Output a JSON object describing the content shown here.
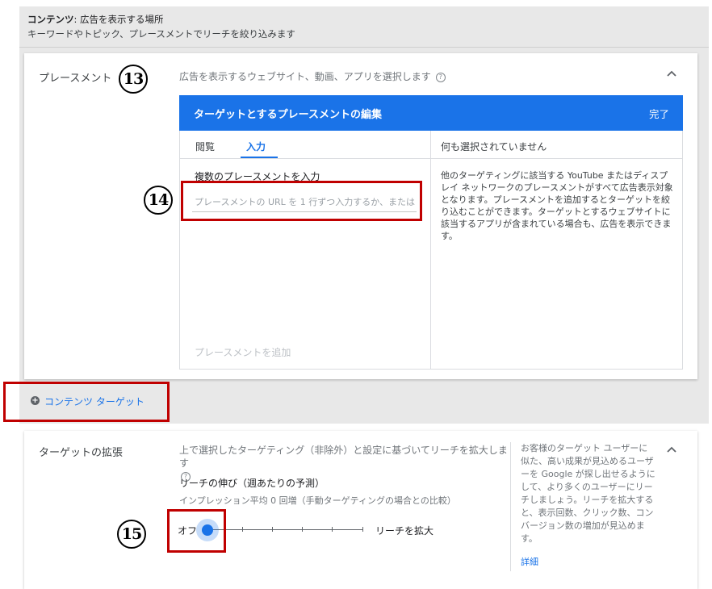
{
  "header": {
    "title_bold": "コンテンツ",
    "title_rest": ": 広告を表示する場所",
    "subtitle": "キーワードやトピック、プレースメントでリーチを絞り込みます"
  },
  "placement": {
    "label": "プレースメント",
    "description": "広告を表示するウェブサイト、動画、アプリを選択します",
    "help_icon": "?",
    "chevron": "^"
  },
  "badges": {
    "b13": "13",
    "b14": "14",
    "b15": "15"
  },
  "editor": {
    "title": "ターゲットとするプレースメントの編集",
    "done": "完了",
    "tabs": [
      "閲覧",
      "入力"
    ],
    "active_tab": "入力",
    "none_selected": "何も選択されていません",
    "multi_label": "複数のプレースメントを入力",
    "url_placeholder": "プレースメントの URL を 1 行ずつ入力するか、または...",
    "add_placement": "プレースメントを追加",
    "info": "他のターゲティングに該当する YouTube またはディスプレイ ネットワークのプレースメントがすべて広告表示対象となります。プレースメントを追加するとターゲットを絞り込むことができます。ターゲットとするウェブサイトに該当するアプリが含まれている場合も、広告を表示できます。"
  },
  "content_target": {
    "icon": "+",
    "link": "コンテンツ ターゲット"
  },
  "expansion": {
    "label": "ターゲットの拡張",
    "description": "上で選択したターゲティング（非除外）と設定に基づいてリーチを拡大します",
    "help_icon": "?",
    "reach_title": "リーチの伸び（週あたりの予測）",
    "impressions": "インプレッション平均 0 回増（手動ターゲティングの場合との比較）",
    "off_label": "オフ",
    "expand_label": "リーチを拡大",
    "slider_level": 0,
    "side_help": "お客様のターゲット ユーザーに似た、高い成果が見込めるユーザーを Google が探し出せるようにして、より多くのユーザーにリーチしましょう。リーチを拡大すると、表示回数、クリック数、コンバージョン数の増加が見込めます。",
    "details": "詳細",
    "chevron": "^"
  },
  "colors": {
    "accent": "#1a73e8",
    "highlight": "#c00000"
  }
}
